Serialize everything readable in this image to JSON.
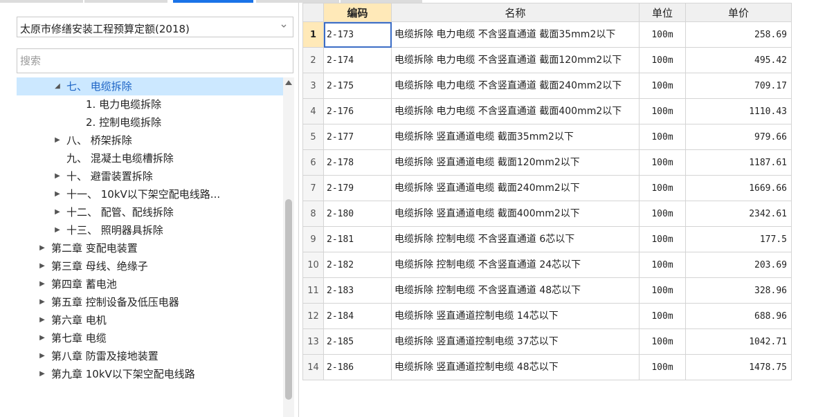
{
  "quota_selector": {
    "selected": "太原市修缮安装工程预算定额(2018)"
  },
  "search": {
    "placeholder": "搜索"
  },
  "tree": {
    "items": [
      {
        "label": "七、 电缆拆除",
        "level": 2,
        "state": "expanded",
        "selected": true
      },
      {
        "label": "1. 电力电缆拆除",
        "level": 3,
        "state": "leaf",
        "selected": false
      },
      {
        "label": "2. 控制电缆拆除",
        "level": 3,
        "state": "leaf",
        "selected": false
      },
      {
        "label": "八、 桥架拆除",
        "level": 2,
        "state": "collapsed",
        "selected": false
      },
      {
        "label": "九、 混凝土电缆槽拆除",
        "level": 2,
        "state": "leaf",
        "selected": false
      },
      {
        "label": "十、 避雷装置拆除",
        "level": 2,
        "state": "collapsed",
        "selected": false
      },
      {
        "label": "十一、 10kV以下架空配电线路...",
        "level": 2,
        "state": "collapsed",
        "selected": false
      },
      {
        "label": "十二、 配管、配线拆除",
        "level": 2,
        "state": "collapsed",
        "selected": false
      },
      {
        "label": "十三、 照明器具拆除",
        "level": 2,
        "state": "collapsed",
        "selected": false
      },
      {
        "label": "第二章 变配电装置",
        "level": 1,
        "state": "collapsed",
        "selected": false
      },
      {
        "label": "第三章 母线、绝缘子",
        "level": 1,
        "state": "collapsed",
        "selected": false
      },
      {
        "label": "第四章 蓄电池",
        "level": 1,
        "state": "collapsed",
        "selected": false
      },
      {
        "label": "第五章 控制设备及低压电器",
        "level": 1,
        "state": "collapsed",
        "selected": false
      },
      {
        "label": "第六章 电机",
        "level": 1,
        "state": "collapsed",
        "selected": false
      },
      {
        "label": "第七章 电缆",
        "level": 1,
        "state": "collapsed",
        "selected": false
      },
      {
        "label": "第八章 防雷及接地装置",
        "level": 1,
        "state": "collapsed",
        "selected": false
      },
      {
        "label": "第九章 10kV以下架空配电线路",
        "level": 1,
        "state": "collapsed",
        "selected": false
      }
    ]
  },
  "table": {
    "headers": {
      "code": "编码",
      "name": "名称",
      "unit": "单位",
      "price": "单价"
    },
    "rows": [
      {
        "idx": "1",
        "code": "2-173",
        "name": "电缆拆除 电力电缆 不含竖直通道 截面35mm2以下",
        "unit": "100m",
        "price": "258.69"
      },
      {
        "idx": "2",
        "code": "2-174",
        "name": "电缆拆除 电力电缆 不含竖直通道 截面120mm2以下",
        "unit": "100m",
        "price": "495.42"
      },
      {
        "idx": "3",
        "code": "2-175",
        "name": "电缆拆除 电力电缆 不含竖直通道 截面240mm2以下",
        "unit": "100m",
        "price": "709.17"
      },
      {
        "idx": "4",
        "code": "2-176",
        "name": "电缆拆除 电力电缆 不含竖直通道 截面400mm2以下",
        "unit": "100m",
        "price": "1110.43"
      },
      {
        "idx": "5",
        "code": "2-177",
        "name": "电缆拆除 竖直通道电缆 截面35mm2以下",
        "unit": "100m",
        "price": "979.66"
      },
      {
        "idx": "6",
        "code": "2-178",
        "name": "电缆拆除 竖直通道电缆 截面120mm2以下",
        "unit": "100m",
        "price": "1187.61"
      },
      {
        "idx": "7",
        "code": "2-179",
        "name": "电缆拆除 竖直通道电缆 截面240mm2以下",
        "unit": "100m",
        "price": "1669.66"
      },
      {
        "idx": "8",
        "code": "2-180",
        "name": "电缆拆除 竖直通道电缆 截面400mm2以下",
        "unit": "100m",
        "price": "2342.61"
      },
      {
        "idx": "9",
        "code": "2-181",
        "name": "电缆拆除 控制电缆 不含竖直通道 6芯以下",
        "unit": "100m",
        "price": "177.5"
      },
      {
        "idx": "10",
        "code": "2-182",
        "name": "电缆拆除 控制电缆 不含竖直通道 24芯以下",
        "unit": "100m",
        "price": "203.69"
      },
      {
        "idx": "11",
        "code": "2-183",
        "name": "电缆拆除 控制电缆 不含竖直通道 48芯以下",
        "unit": "100m",
        "price": "328.96"
      },
      {
        "idx": "12",
        "code": "2-184",
        "name": "电缆拆除 竖直通道控制电缆 14芯以下",
        "unit": "100m",
        "price": "688.96"
      },
      {
        "idx": "13",
        "code": "2-185",
        "name": "电缆拆除 竖直通道控制电缆 37芯以下",
        "unit": "100m",
        "price": "1042.71"
      },
      {
        "idx": "14",
        "code": "2-186",
        "name": "电缆拆除 竖直通道控制电缆 48芯以下",
        "unit": "100m",
        "price": "1478.75"
      }
    ]
  },
  "colors": {
    "accent": "#1a73e8",
    "selection_bg": "#cce8ff",
    "selection_text": "#1c63c5",
    "header_highlight": "#ffe9b8"
  }
}
